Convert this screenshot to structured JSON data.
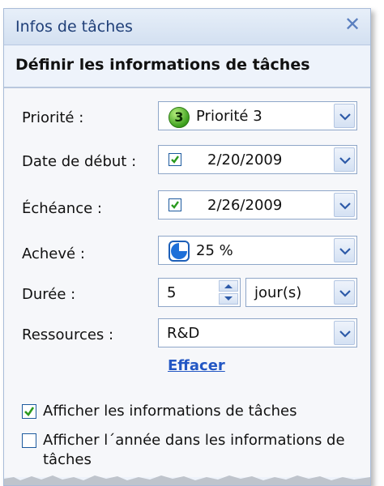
{
  "panel": {
    "title": "Infos de tâches",
    "close_glyph": "✕",
    "section_header": "Définir les informations de tâches"
  },
  "fields": {
    "priority": {
      "label": "Priorité :",
      "badge": "3",
      "value": "Priorité 3"
    },
    "start_date": {
      "label": "Date de début :",
      "checked": true,
      "value": "2/20/2009"
    },
    "due_date": {
      "label": "Échéance :",
      "checked": true,
      "value": "2/26/2009"
    },
    "completed": {
      "label": "Achevé :",
      "value": "25 %",
      "percent": 25
    },
    "duration": {
      "label": "Durée :",
      "value": "5",
      "unit": "jour(s)"
    },
    "resources": {
      "label": "Ressources :",
      "value": "R&D"
    }
  },
  "clear_link": "Effacer",
  "options": {
    "show_task_info": {
      "label": "Afficher les informations de tâches",
      "checked": true
    },
    "show_year": {
      "label_line1": "Afficher l´année dans les informations de",
      "label_line2": "tâches",
      "checked": false
    }
  },
  "colors": {
    "title_text": "#1f3f78",
    "link": "#2357c4",
    "accent_blue": "#1d5a9e",
    "check_green": "#2b9a1e",
    "panel_bg": "#eef3fb"
  },
  "icons": {
    "close": "close-icon",
    "priority": "priority-3-icon",
    "dropdown": "chevron-down-icon",
    "completion": "pie-25-percent-icon",
    "spinner_up": "spin-up-icon",
    "spinner_down": "spin-down-icon"
  }
}
